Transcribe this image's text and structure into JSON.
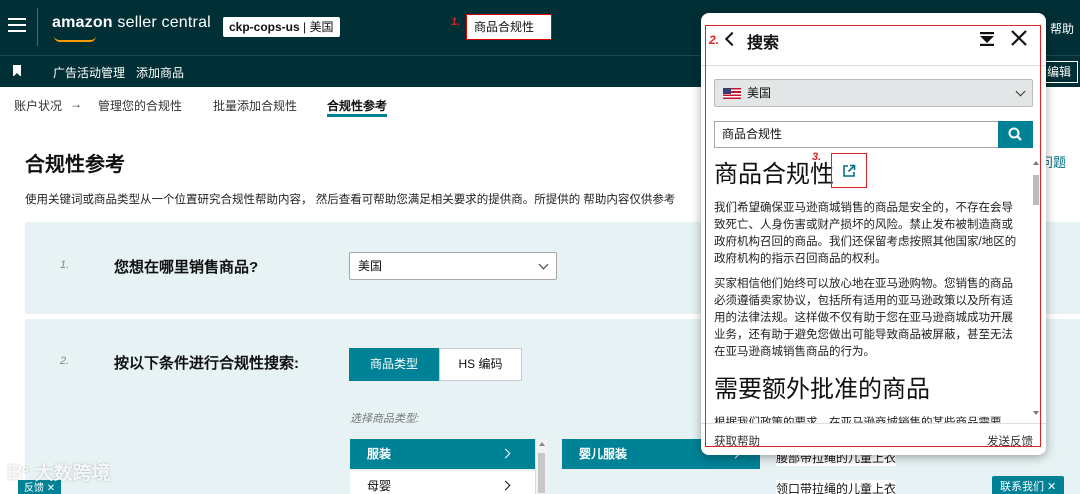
{
  "header": {
    "logo_text_bold": "amazon",
    "logo_text": " seller central",
    "account_bold": "ckp-cops-us",
    "account_sep": " | ",
    "account_region": "美国",
    "search_value": "商品合规性",
    "help": "帮助",
    "annotation_1": "1."
  },
  "subbar": {
    "links": [
      "广告活动管理",
      "添加商品"
    ],
    "edit": "编辑"
  },
  "breadcrumb": {
    "items": [
      "账户状况",
      "→",
      "管理您的合规性",
      "批量添加合规性",
      "合规性参考"
    ]
  },
  "page": {
    "title": "合规性参考",
    "description": "使用关键词或商品类型从一个位置研究合规性帮助内容，  然后查看可帮助您满足相关要求的提供商。所提供的 帮助内容仅供参考",
    "right_peek": "问题"
  },
  "step1": {
    "number": "1.",
    "question": "您想在哪里销售商品?",
    "select_value": "美国"
  },
  "step2": {
    "number": "2.",
    "question": "按以下条件进行合规性搜索:",
    "tab_active": "商品类型",
    "tab_inactive": "HS 编码",
    "hint": "选择商品类型:",
    "categories": [
      {
        "label": "服装",
        "active": true
      },
      {
        "label": "母婴",
        "active": false
      }
    ],
    "subcategory": "婴儿服装",
    "list_items": [
      "腰部带拉绳的儿童上衣",
      "领口带拉绳的儿童上衣"
    ]
  },
  "help_panel": {
    "annotation_2": "2.",
    "annotation_3": "3.",
    "title": "搜索",
    "country": "美国",
    "search_value": "商品合规性",
    "heading1": "商品合规性",
    "para1": "我们希望确保亚马逊商城销售的商品是安全的，不存在会导致死亡、人身伤害或财产损坏的风险。禁止发布被制造商或政府机构召回的商品。我们还保留考虑按照其他国家/地区的政府机构的指示召回商品的权利。",
    "para2": "买家相信他们始终可以放心地在亚马逊购物。您销售的商品必须遵循卖家协议，包括所有适用的亚马逊政策以及所有适用的法律法规。这样做不仅有助于您在亚马逊商城成功开展业务，还有助于避免您做出可能导致商品被屏蔽，甚至无法在亚马逊商城销售商品的行为。",
    "heading2": "需要额外批准的商品",
    "para3": "根据我们政策的要求，在亚马逊商城销售的某些商品需要",
    "footer_left": "获取帮助",
    "footer_right": "发送反馈"
  },
  "misc": {
    "contact": "联系我们",
    "feedback": "反馈",
    "watermark": "大数跨境"
  },
  "colors": {
    "nav_bg": "#002f36",
    "teal": "#008296",
    "panel_bg": "#e6f2f3",
    "annotation_red": "#d22"
  }
}
